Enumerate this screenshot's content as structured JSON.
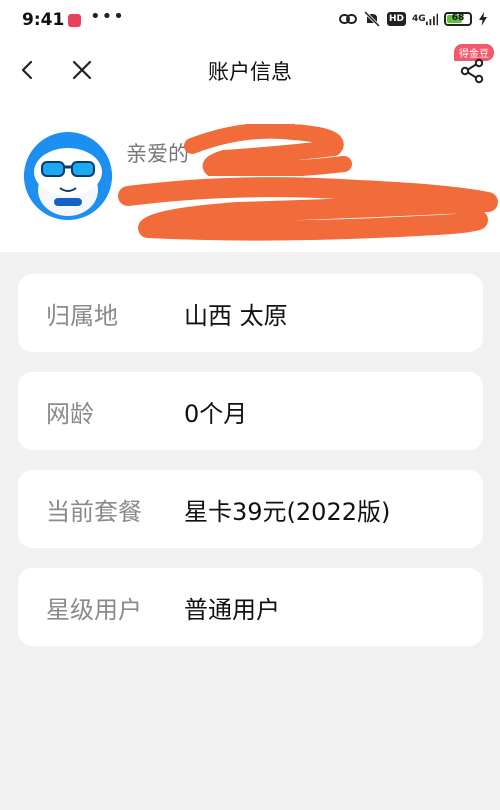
{
  "status_bar": {
    "time": "9:41",
    "network": "4G",
    "hd": "HD",
    "battery": "68",
    "battery_level": 0.68,
    "battery_color": "#5bc236"
  },
  "nav": {
    "title": "账户信息",
    "badge": "得金豆",
    "back_icon": "chevron-left-icon",
    "close_icon": "close-icon",
    "share_icon": "share-icon"
  },
  "profile": {
    "greeting": "亲爱的",
    "avatar_icon": "mascot-avatar",
    "redaction_color": "#f26b3a"
  },
  "info": [
    {
      "label": "归属地",
      "value": "山西 太原"
    },
    {
      "label": "网龄",
      "value": "0个月"
    },
    {
      "label": "当前套餐",
      "value": "星卡39元(2022版)"
    },
    {
      "label": "星级用户",
      "value": "普通用户"
    }
  ]
}
